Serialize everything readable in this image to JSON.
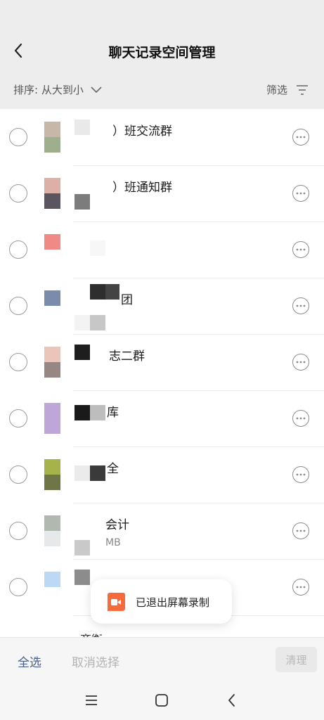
{
  "header": {
    "title": "聊天记录空间管理",
    "sort_label": "排序: 从大到小",
    "filter_label": "筛选"
  },
  "rows": [
    {
      "name": "）班交流群",
      "size": "",
      "thumb": [
        "#c7b7a9",
        "#9fae8c"
      ]
    },
    {
      "name": "）班通知群",
      "size": "",
      "thumb": [
        "#dcb0a6",
        "#5b5560"
      ]
    },
    {
      "name": "",
      "size": "",
      "thumb": [
        "#ef8a86",
        "#ffffff"
      ]
    },
    {
      "name": "团",
      "size": "",
      "thumb": [
        "#7a8bab",
        "#ffffff"
      ]
    },
    {
      "name": "志二群",
      "size": "",
      "thumb": [
        "#ebc4ba",
        "#978784"
      ]
    },
    {
      "name": "库",
      "size": "",
      "thumb": [
        "#bea7d8",
        "#bea7d8"
      ]
    },
    {
      "name": "全",
      "size": "",
      "thumb": [
        "#a6b24a",
        "#6f7546"
      ]
    },
    {
      "name": "会计",
      "size": "MB",
      "thumb": [
        "#b0b8b0",
        "#e6e8e9"
      ]
    },
    {
      "name": "",
      "size": "",
      "thumb": [
        "#bcd8f5",
        "#ffffff"
      ]
    }
  ],
  "partial_row": {
    "name": "齐衡"
  },
  "toast": {
    "text": "已退出屏幕录制",
    "icon": "screen-record-icon",
    "color": "#f56b3c"
  },
  "bottom": {
    "select_all": "全选",
    "cancel_select": "取消选择",
    "clean": "清理"
  },
  "colors": {
    "accent": "#4a5d8a",
    "header_bg": "#ededed"
  }
}
